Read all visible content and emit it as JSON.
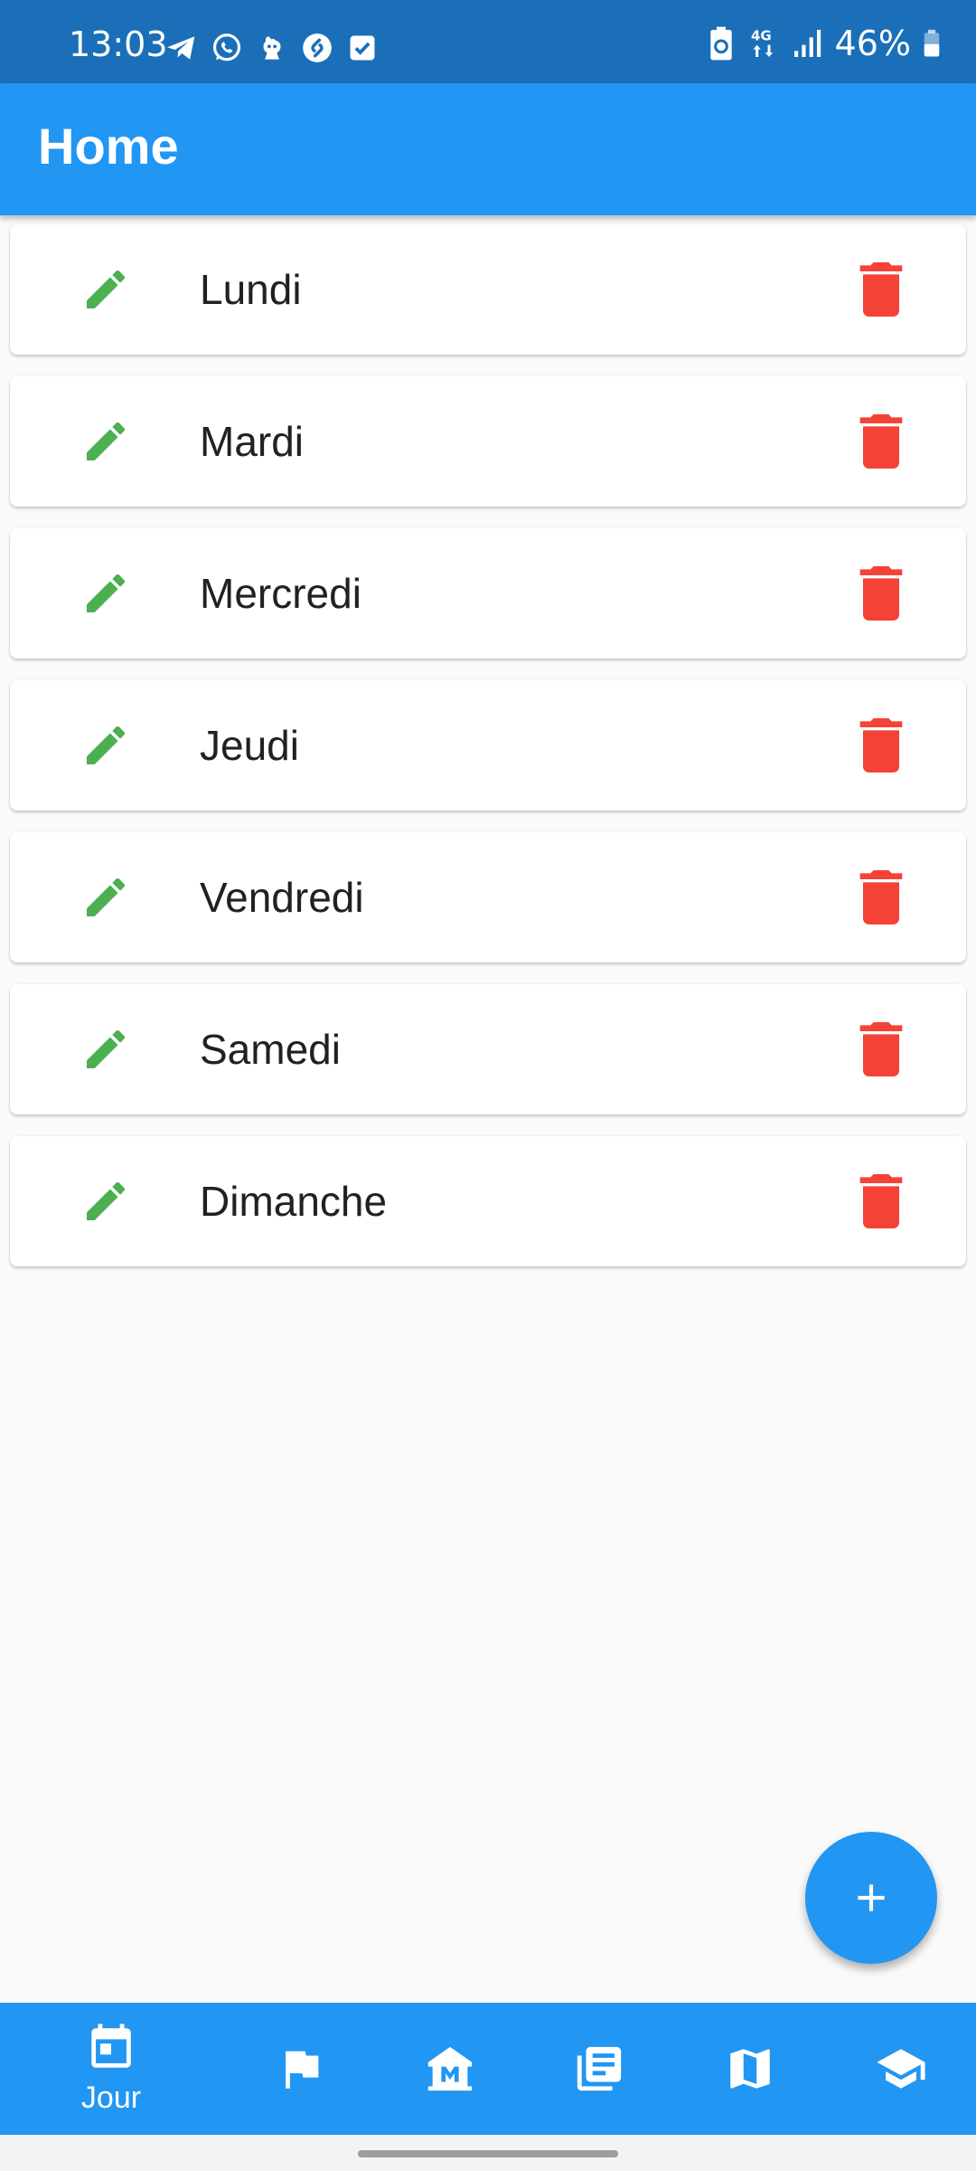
{
  "status_bar": {
    "time": "13:03",
    "left_icons": [
      "telegram-icon",
      "whatsapp-icon",
      "duolingo-icon",
      "shazam-icon",
      "tasks-icon"
    ],
    "right_icons": [
      "battery-saver-icon",
      "network-4g-icon",
      "signal-icon"
    ],
    "battery_text": "46%"
  },
  "app_bar": {
    "title": "Home"
  },
  "days": [
    {
      "label": "Lundi"
    },
    {
      "label": "Mardi"
    },
    {
      "label": "Mercredi"
    },
    {
      "label": "Jeudi"
    },
    {
      "label": "Vendredi"
    },
    {
      "label": "Samedi"
    },
    {
      "label": "Dimanche"
    }
  ],
  "icons": {
    "edit": "pencil-icon",
    "delete": "trash-icon",
    "add": "plus-icon"
  },
  "bottom_nav": {
    "items": [
      {
        "icon": "calendar-icon",
        "label": "Jour",
        "selected": true
      },
      {
        "icon": "flag-icon",
        "label": "",
        "selected": false
      },
      {
        "icon": "museum-icon",
        "label": "",
        "selected": false
      },
      {
        "icon": "library-books-icon",
        "label": "",
        "selected": false
      },
      {
        "icon": "map-icon",
        "label": "",
        "selected": false
      },
      {
        "icon": "school-icon",
        "label": "",
        "selected": false
      }
    ]
  },
  "colors": {
    "status_bar": "#1a6fb8",
    "primary": "#2196f3",
    "edit": "#4caf50",
    "delete": "#f44336",
    "background": "#fafafa",
    "card": "#ffffff",
    "text": "#212121"
  }
}
